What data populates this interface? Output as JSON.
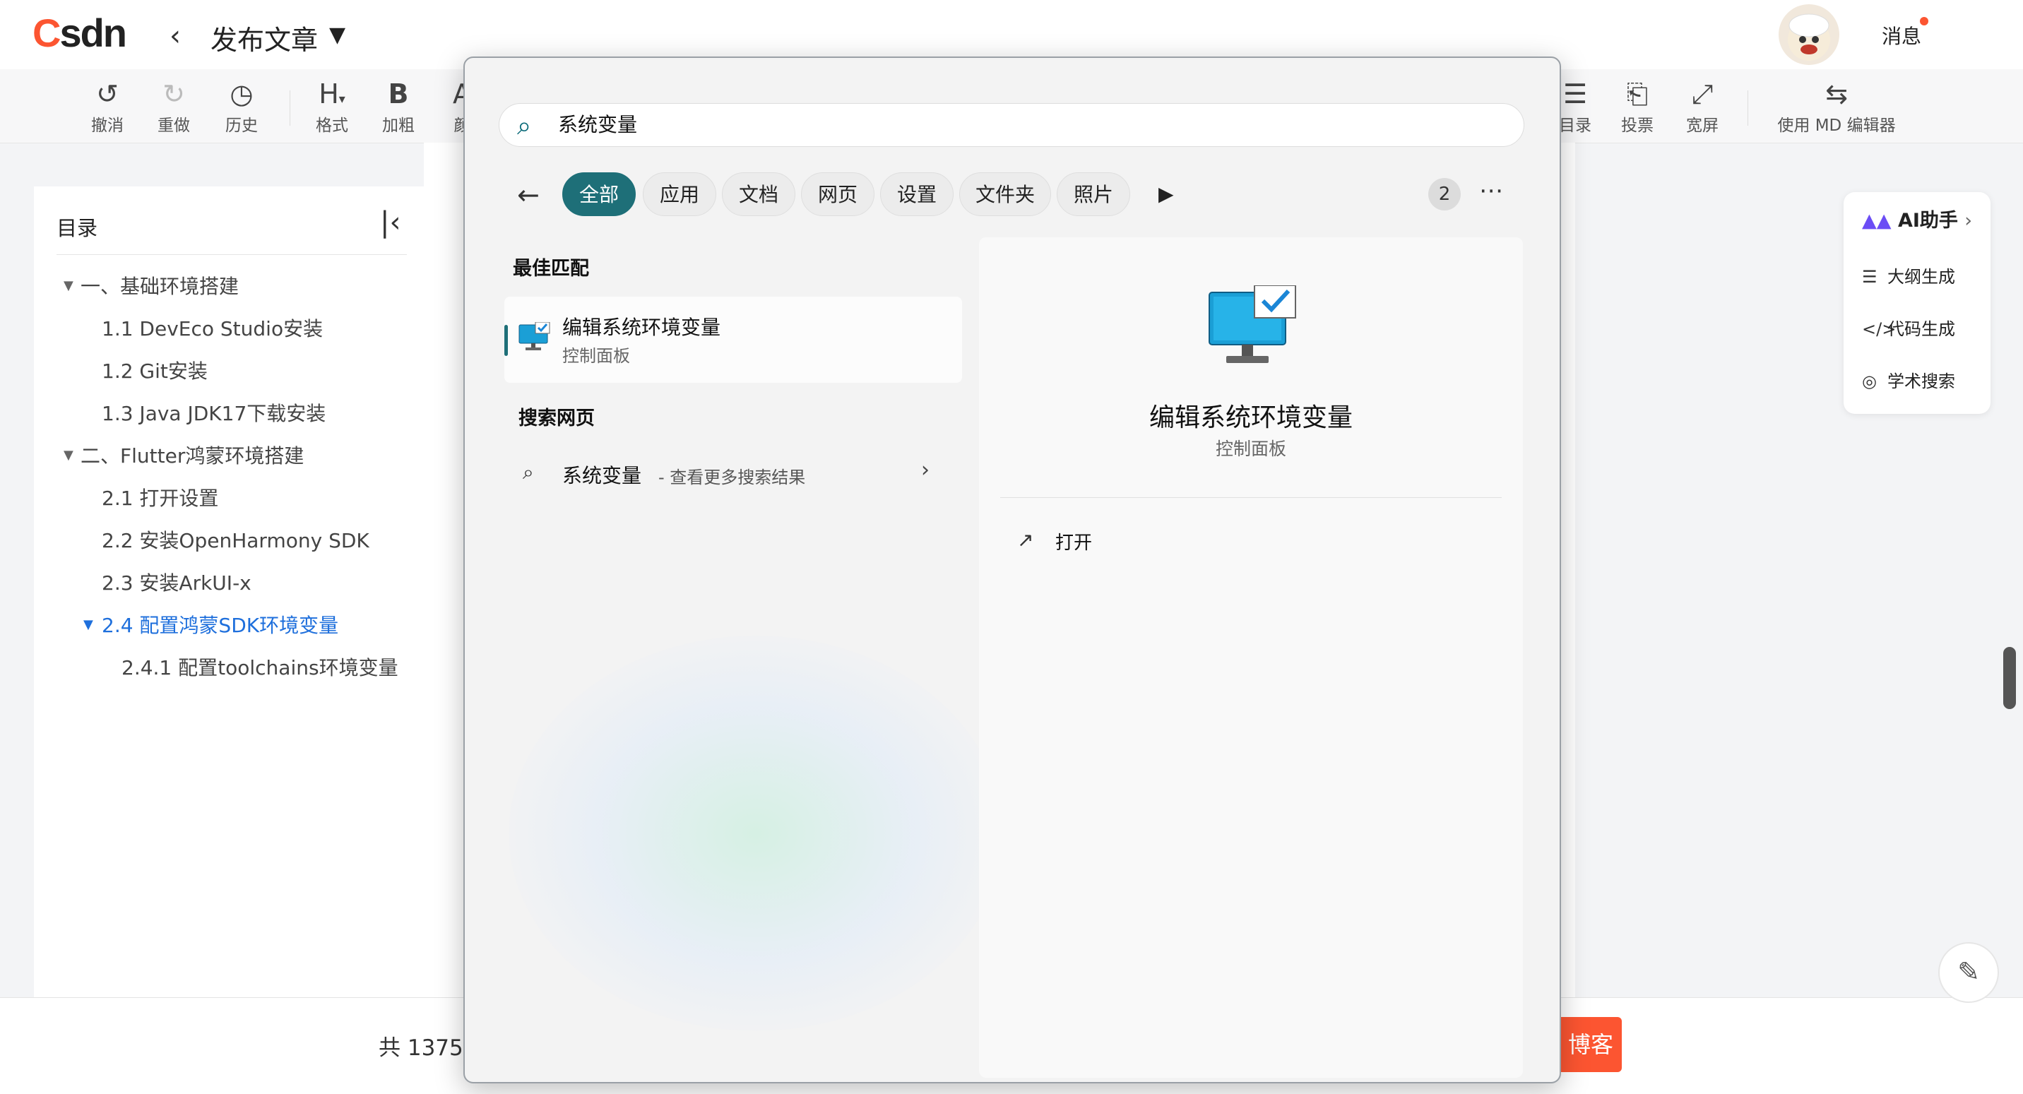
{
  "app": {
    "logo_c": "C",
    "logo_rest": "SDN",
    "page_title": "发布文章",
    "messages_label": "消息"
  },
  "toolbar": {
    "undo": "撤消",
    "redo": "重做",
    "history": "历史",
    "format": "格式",
    "bold": "加粗",
    "color": "颜",
    "toc": "目录",
    "vote": "投票",
    "widescreen": "宽屏",
    "md_editor": "使用 MD 编辑器"
  },
  "toc": {
    "title": "目录",
    "items": [
      {
        "label": "一、基础环境搭建",
        "level": 1,
        "collapsible": true
      },
      {
        "label": "1.1 DevEco Studio安装",
        "level": 2
      },
      {
        "label": "1.2 Git安装",
        "level": 2
      },
      {
        "label": "1.3 Java JDK17下载安装",
        "level": 2
      },
      {
        "label": "二、Flutter鸿蒙环境搭建",
        "level": 1,
        "collapsible": true
      },
      {
        "label": "2.1 打开设置",
        "level": 2
      },
      {
        "label": "2.2 安装OpenHarmony SDK",
        "level": 2
      },
      {
        "label": "2.3 安装ArkUI-x",
        "level": 2
      },
      {
        "label": "2.4 配置鸿蒙SDK环境变量",
        "level": 2,
        "collapsible": true,
        "active": true
      },
      {
        "label": "2.4.1 配置toolchains环境变量",
        "level": 3
      }
    ]
  },
  "footer": {
    "word_count": "共 1375",
    "publish_label": "博客"
  },
  "ai_panel": {
    "title": "AI助手",
    "outline": "大纲生成",
    "code": "代码生成",
    "academic": "学术搜索"
  },
  "search_popup": {
    "query": "系统变量",
    "filters": [
      "全部",
      "应用",
      "文档",
      "网页",
      "设置",
      "文件夹",
      "照片"
    ],
    "count_badge": "2",
    "best_match_heading": "最佳匹配",
    "best_match": {
      "title": "编辑系统环境变量",
      "subtitle": "控制面板"
    },
    "web_heading": "搜索网页",
    "web_result": {
      "query": "系统变量",
      "hint": "- 查看更多搜索结果"
    },
    "preview": {
      "title": "编辑系统环境变量",
      "subtitle": "控制面板",
      "open_label": "打开"
    }
  },
  "colors": {
    "brand": "#fc5531",
    "accent_teal": "#1e6f78",
    "toc_active": "#1e6fdc"
  }
}
